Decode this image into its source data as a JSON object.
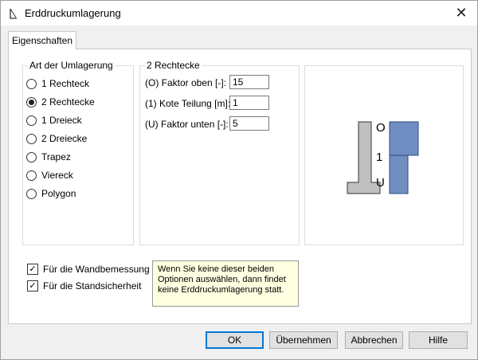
{
  "window": {
    "title": "Erddruckumlagerung",
    "close_glyph": "✕"
  },
  "tabs": [
    {
      "label": "Eigenschaften"
    }
  ],
  "redistribution": {
    "group_label": "Art der Umlagerung",
    "options": [
      {
        "label": "1 Rechteck",
        "selected": false
      },
      {
        "label": "2 Rechtecke",
        "selected": true
      },
      {
        "label": "1 Dreieck",
        "selected": false
      },
      {
        "label": "2 Dreiecke",
        "selected": false
      },
      {
        "label": "Trapez",
        "selected": false
      },
      {
        "label": "Viereck",
        "selected": false
      },
      {
        "label": "Polygon",
        "selected": false
      }
    ]
  },
  "params": {
    "group_label": "2 Rechtecke",
    "fields": [
      {
        "label": "(O) Faktor oben [-]:",
        "value": "15"
      },
      {
        "label": "(1) Kote Teilung [m]:",
        "value": "1"
      },
      {
        "label": "(U) Faktor unten [-]:",
        "value": "5"
      }
    ]
  },
  "preview": {
    "label_top": "O",
    "label_mid": "1",
    "label_bottom": "U"
  },
  "checks": [
    {
      "label": "Für die Wandbemessung",
      "checked": true
    },
    {
      "label": "Für die Standsicherheit",
      "checked": true
    }
  ],
  "checkmark": "✓",
  "tooltip": {
    "line1": "Wenn Sie keine dieser beiden",
    "line2": "Optionen auswählen, dann findet",
    "line3": "keine Erddruckumlagerung statt."
  },
  "buttons": {
    "ok": "OK",
    "apply": "Übernehmen",
    "cancel": "Abbrechen",
    "help": "Hilfe"
  },
  "colors": {
    "wall": "#c0c0c0",
    "pressure": "#6f8fc2",
    "tooltip_bg": "#ffffe1",
    "accent": "#0078d7"
  }
}
